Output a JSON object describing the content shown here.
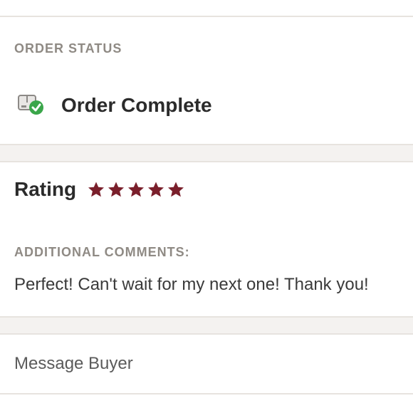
{
  "order_status": {
    "label": "ORDER STATUS",
    "status_text": "Order Complete",
    "icon": "package-check-icon"
  },
  "rating": {
    "label": "Rating",
    "stars": 5,
    "star_color": "#7a1f2b"
  },
  "comments": {
    "label": "ADDITIONAL COMMENTS:",
    "text": "Perfect! Can't wait for my next one! Thank you!"
  },
  "actions": {
    "message_buyer_label": "Message Buyer"
  }
}
